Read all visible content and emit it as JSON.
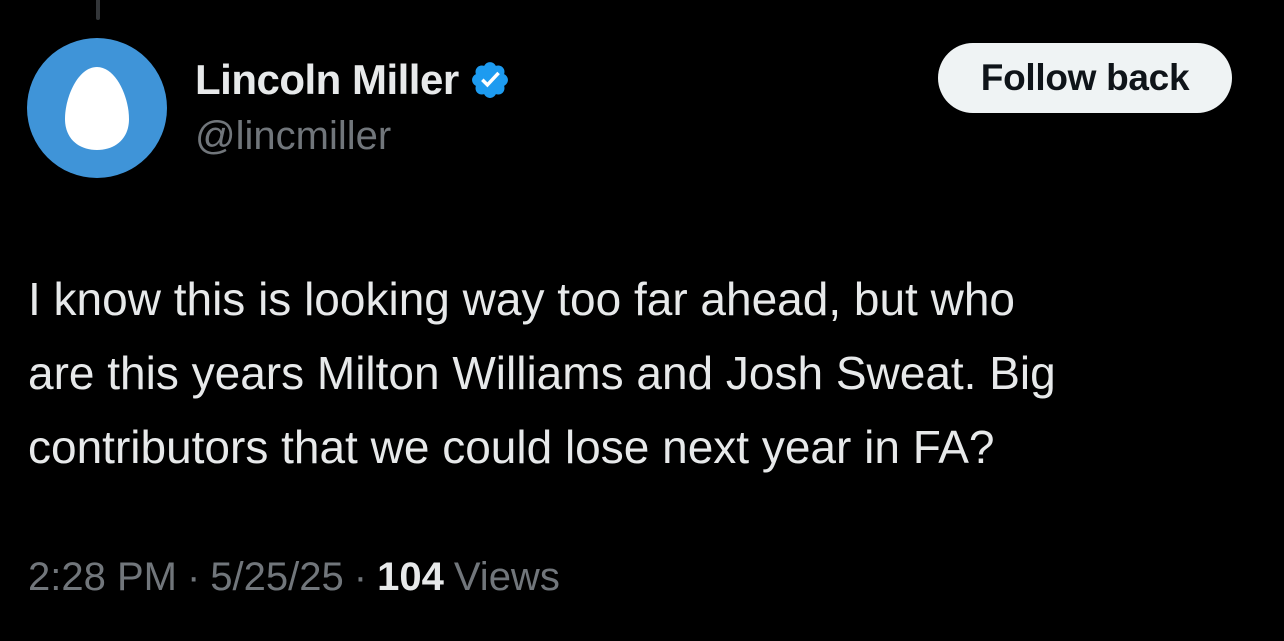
{
  "colors": {
    "background": "#000000",
    "primary_text": "#e7e9ea",
    "secondary_text": "#71767b",
    "avatar_bg": "#3f94d8",
    "verified_badge": "#1d9bf0",
    "button_bg": "#eff3f4",
    "button_text": "#0f1419"
  },
  "author": {
    "avatar_icon": "egg-avatar-icon",
    "display_name": "Lincoln Miller",
    "verified_icon": "verified-badge-icon",
    "handle": "@lincmiller"
  },
  "follow_button": {
    "label": "Follow back"
  },
  "tweet": {
    "text_lines": [
      "I know this is looking way too far ahead, but who",
      "are this years Milton Williams and Josh Sweat. Big",
      "contributors that we could lose next year in FA?"
    ]
  },
  "meta": {
    "time": "2:28 PM",
    "separator": "·",
    "date": "5/25/25",
    "views_count": "104",
    "views_label": "Views"
  }
}
